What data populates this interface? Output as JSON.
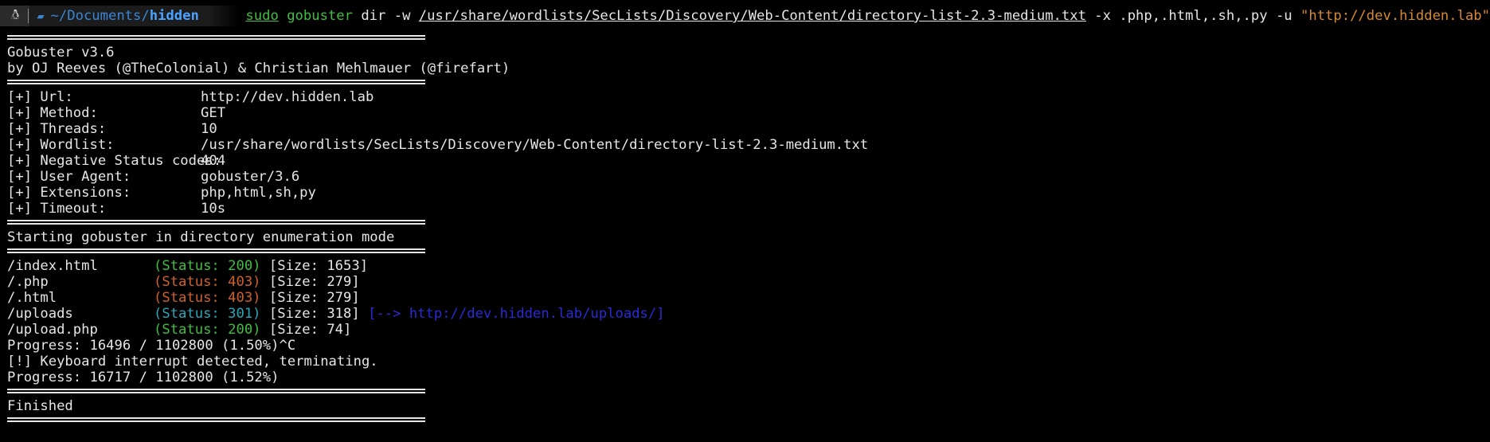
{
  "prompt": {
    "os_icon": "linux-tux-icon",
    "folder_icon": "folder-open-icon",
    "path_prefix": "~/Documents/",
    "path_current": "hidden",
    "cmd_sudo": "sudo",
    "cmd_program": "gobuster",
    "cmd_args1": " dir -w ",
    "cmd_wordlist": "/usr/share/wordlists/SecLists/Discovery/Web-Content/directory-list-2.3-medium.txt",
    "cmd_args2": " -x .php,.html,.sh,.py -u ",
    "cmd_url": "\"http://dev.hidden.lab\""
  },
  "banner": {
    "version": "Gobuster v3.6",
    "authors": "by OJ Reeves (@TheColonial) & Christian Mehlmauer (@firefart)"
  },
  "config": [
    {
      "key": "[+] Url:",
      "value": "http://dev.hidden.lab"
    },
    {
      "key": "[+] Method:",
      "value": "GET"
    },
    {
      "key": "[+] Threads:",
      "value": "10"
    },
    {
      "key": "[+] Wordlist:",
      "value": "/usr/share/wordlists/SecLists/Discovery/Web-Content/directory-list-2.3-medium.txt"
    },
    {
      "key": "[+] Negative Status codes:",
      "value": "404"
    },
    {
      "key": "[+] User Agent:",
      "value": "gobuster/3.6"
    },
    {
      "key": "[+] Extensions:",
      "value": "php,html,sh,py"
    },
    {
      "key": "[+] Timeout:",
      "value": "10s"
    }
  ],
  "start_message": "Starting gobuster in directory enumeration mode",
  "results": [
    {
      "path": "/index.html",
      "status": "(Status: 200)",
      "size": "[Size: 1653]",
      "redirect": ""
    },
    {
      "path": "/.php",
      "status": "(Status: 403)",
      "size": "[Size: 279]",
      "redirect": ""
    },
    {
      "path": "/.html",
      "status": "(Status: 403)",
      "size": "[Size: 279]",
      "redirect": ""
    },
    {
      "path": "/uploads",
      "status": "(Status: 301)",
      "size": "[Size: 318]",
      "redirect": "[--> http://dev.hidden.lab/uploads/]"
    },
    {
      "path": "/upload.php",
      "status": "(Status: 200)",
      "size": "[Size: 74]",
      "redirect": ""
    }
  ],
  "progress_1": "Progress: 16496 / 1102800 (1.50%)^C",
  "interrupt": "[!] Keyboard interrupt detected, terminating.",
  "progress_2": "Progress: 16717 / 1102800 (1.52%)",
  "finished": "Finished",
  "colors": {
    "background": "#000000",
    "foreground": "#e6e6e6",
    "status_200": "#3fbf3f",
    "status_403": "#d0602a",
    "status_301": "#2aa8b8",
    "redirect": "#2a2ad6",
    "string": "#d78a2b",
    "path": "#4aa3ff"
  }
}
